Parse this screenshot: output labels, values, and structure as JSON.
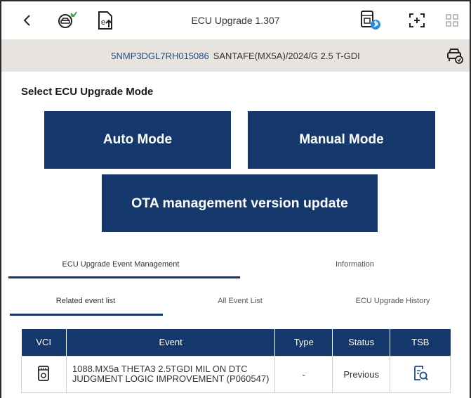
{
  "app": {
    "title": "ECU Upgrade 1.307"
  },
  "toolbar": {
    "back_icon": "chevron-left-icon",
    "diagnostic_icon": "vehicle-diagnostic-icon",
    "export_icon": "file-upload-icon",
    "vci_bluetooth_icon": "vci-bluetooth-icon",
    "capture_icon": "screen-capture-icon",
    "grid_icon": "grid-icon"
  },
  "vehicle": {
    "vin": "5NMP3DGL7RH015086",
    "description": "SANTAFE(MX5A)/2024/G 2.5 T-GDI",
    "icon": "vehicle-settings-icon"
  },
  "main": {
    "section_title": "Select ECU Upgrade Mode",
    "buttons": {
      "auto": "Auto Mode",
      "manual": "Manual Mode",
      "ota": "OTA management version update"
    }
  },
  "tabs_primary": [
    {
      "label": "ECU Upgrade Event Management",
      "active": true
    },
    {
      "label": "Information",
      "active": false
    }
  ],
  "tabs_secondary": [
    {
      "label": "Related event list",
      "active": true
    },
    {
      "label": "All Event List",
      "active": false
    },
    {
      "label": "ECU Upgrade History",
      "active": false
    }
  ],
  "table": {
    "headers": [
      "VCI",
      "Event",
      "Type",
      "Status",
      "TSB"
    ],
    "rows": [
      {
        "vci_icon": "vci-device-icon",
        "event": "1088.MX5a THETA3 2.5TGDI MIL ON DTC JUDGMENT LOGIC IMPROVEMENT (P060547)",
        "type": "-",
        "status": "Previous",
        "tsb_icon": "document-search-icon"
      }
    ]
  },
  "colors": {
    "primary": "#14386b",
    "vehicle_bar": "#e7e3df",
    "vin_text": "#1f4e8c",
    "bluetooth": "#2a8de0"
  }
}
